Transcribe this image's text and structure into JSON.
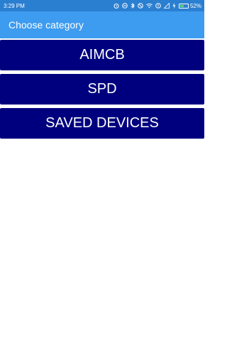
{
  "status_bar": {
    "time": "3:29 PM",
    "battery_percent": "52%",
    "battery_level": 0.52,
    "icons": [
      "alarm-icon",
      "no-disturb-icon",
      "bluetooth-icon",
      "silent-icon",
      "wifi-icon",
      "no-sim-icon",
      "signal-icon",
      "charging-icon",
      "battery-icon"
    ]
  },
  "app_bar": {
    "title": "Choose category",
    "color": "#3d9bf0"
  },
  "categories": [
    {
      "label": "AIMCB"
    },
    {
      "label": "SPD"
    },
    {
      "label": "SAVED DEVICES"
    }
  ],
  "colors": {
    "button_bg": "#00007f",
    "status_bar": "#2b7fd1"
  }
}
